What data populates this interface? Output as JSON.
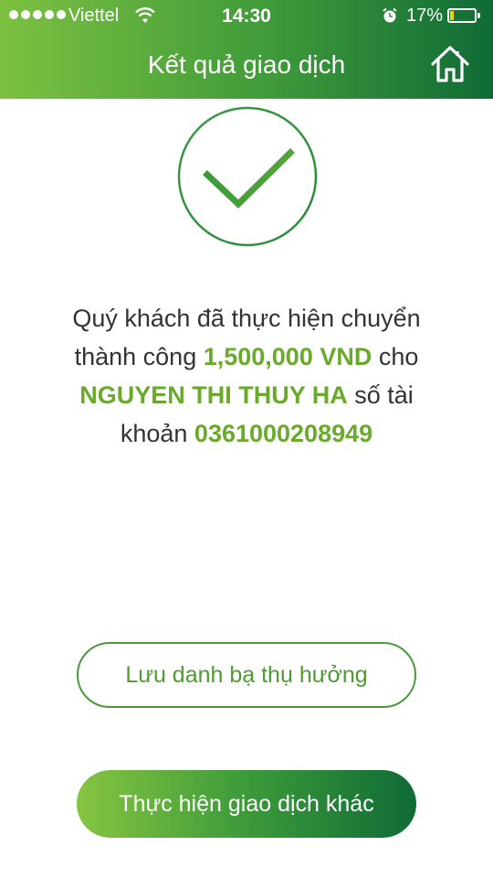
{
  "status_bar": {
    "carrier": "Viettel",
    "time": "14:30",
    "battery_percent": "17%",
    "battery_level": 0.17,
    "signal_icon": "signal-dots-icon",
    "wifi_icon": "wifi-icon",
    "alarm_icon": "alarm-icon"
  },
  "header": {
    "title": "Kết quả giao dịch",
    "home_icon": "home-icon"
  },
  "result": {
    "icon": "checkmark-circle-icon",
    "text_intro": "Quý khách đã thực hiện chuyển thành công ",
    "amount": "1,500,000 VND",
    "text_for": " cho ",
    "recipient": "NGUYEN THI THUY HA",
    "text_account": " số tài khoản ",
    "account_number": "0361000208949"
  },
  "buttons": {
    "save_beneficiary": "Lưu danh bạ thụ hưởng",
    "new_transaction": "Thực hiện giao dịch khác"
  },
  "colors": {
    "accent_green": "#6aaa2a",
    "dark_green": "#0f6b36",
    "light_green": "#7cc141"
  }
}
